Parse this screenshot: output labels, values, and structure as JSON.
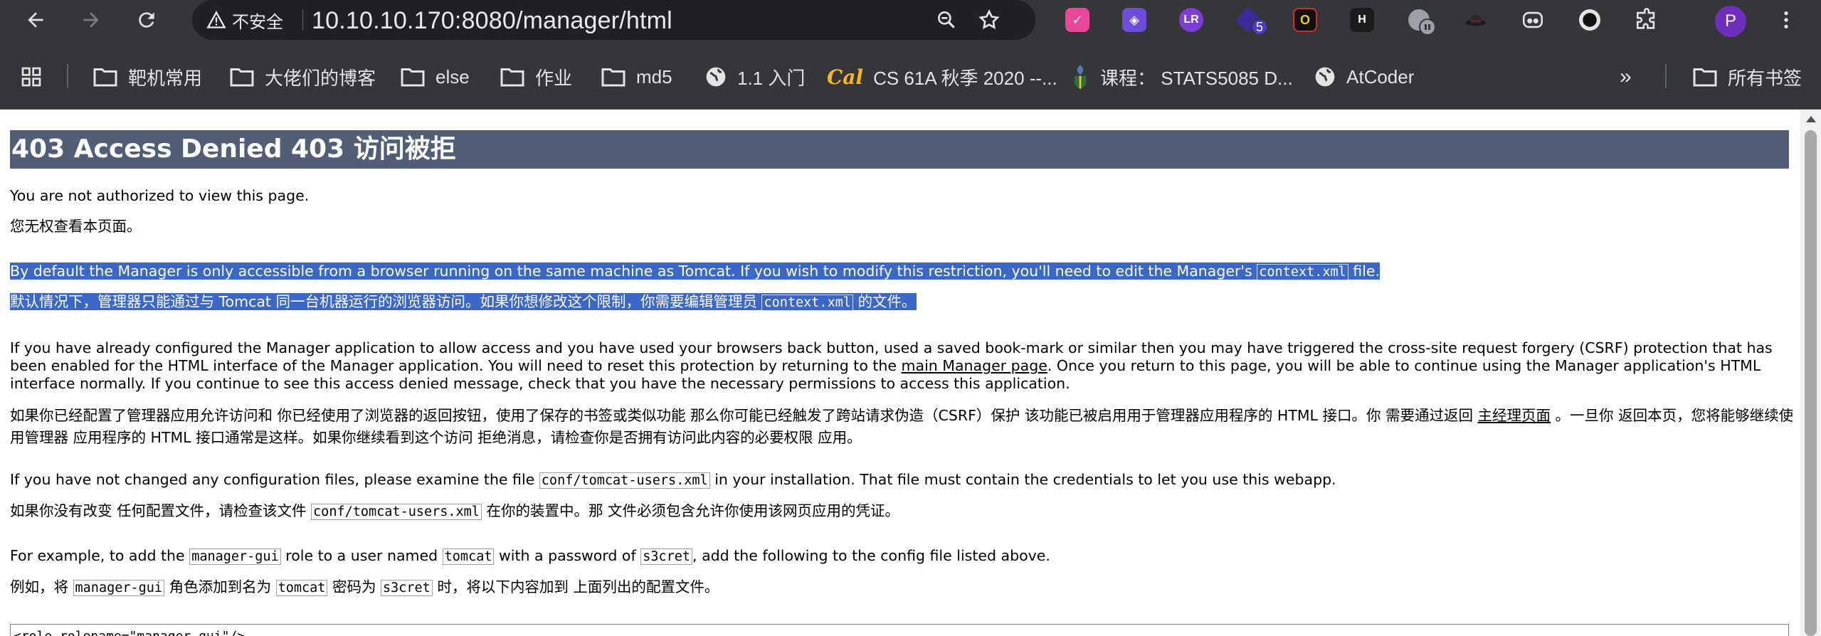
{
  "browser": {
    "security_label": "不安全",
    "url": "10.10.10.170:8080/manager/html",
    "extension_badge": "5",
    "profile_initial": "P"
  },
  "bookmarks": {
    "items": [
      {
        "label": "靶机常用",
        "icon": "folder-icon"
      },
      {
        "label": "大佬们的博客",
        "icon": "folder-icon"
      },
      {
        "label": "else",
        "icon": "folder-icon"
      },
      {
        "label": "作业",
        "icon": "folder-icon"
      },
      {
        "label": "md5",
        "icon": "folder-icon"
      },
      {
        "label": "1.1 入门",
        "icon": "globe-icon"
      },
      {
        "label": "CS 61A 秋季 2020 --...",
        "icon": "cal-logo-icon"
      },
      {
        "label": "课程： STATS5085 D...",
        "icon": "crest-icon"
      },
      {
        "label": "AtCoder",
        "icon": "globe-icon"
      }
    ],
    "more_label": "»",
    "all_bookmarks": "所有书签"
  },
  "page": {
    "heading": "403 Access Denied  403 访问被拒",
    "p1_en": "You are not authorized to view this page.",
    "p1_zh": "您无权查看本页面。",
    "p2_en_a": "By default the Manager is only accessible from a browser running on the same machine as Tomcat. If you wish to modify this restriction, you'll need to edit the Manager's ",
    "p2_code": "context.xml",
    "p2_en_b": " file.",
    "p2_zh_a": "默认情况下，管理器只能通过与 Tomcat 同一台机器运行的浏览器访问。如果你想修改这个限制，你需要编辑管理员 ",
    "p2_zh_b": " 的文件。",
    "p3_en_a": "If you have already configured the Manager application to allow access and you have used your browsers back button, used a saved book-mark or similar then you may have triggered the cross-site request forgery (CSRF) protection that has been enabled for the HTML interface of the Manager application. You will need to reset this protection by returning to the ",
    "p3_link": "main Manager page",
    "p3_en_b": ". Once you return to this page, you will be able to continue using the Manager application's HTML interface normally. If you continue to see this access denied message, check that you have the necessary permissions to access this application.",
    "p3_zh_a": "如果你已经配置了管理器应用允许访问和 你已经使用了浏览器的返回按钮，使用了保存的书签或类似功能 那么你可能已经触发了跨站请求伪造（CSRF）保护 该功能已被启用用于管理器应用程序的 HTML 接口。你 需要通过返回 ",
    "p3_zh_link": "主经理页面",
    "p3_zh_b": " 。一旦你 返回本页，您将能够继续使用管理器 应用程序的 HTML 接口通常是这样。如果你继续看到这个访问 拒绝消息，请检查你是否拥有访问此内容的必要权限 应用。",
    "p4_en_a": "If you have not changed any configuration files, please examine the file ",
    "p4_code": "conf/tomcat-users.xml",
    "p4_en_b": " in your installation. That file must contain the credentials to let you use this webapp.",
    "p4_zh_a": "如果你没有改变 任何配置文件，请检查该文件 ",
    "p4_zh_b": " 在你的装置中。那 文件必须包含允许你使用该网页应用的凭证。",
    "p5_en_a": "For example, to add the ",
    "p5_code_role": "manager-gui",
    "p5_en_b": " role to a user named ",
    "p5_code_user": "tomcat",
    "p5_en_c": " with a password of ",
    "p5_code_pass": "s3cret",
    "p5_en_d": ", add the following to the config file listed above.",
    "p5_zh_a": "例如，将 ",
    "p5_zh_b": " 角色添加到名为 ",
    "p5_zh_c": " 密码为 ",
    "p5_zh_d": " 时，将以下内容加到 上面列出的配置文件。",
    "pre_line": "<role rolename=\"manager-gui\"/>"
  },
  "colors": {
    "toolbar_bg": "#35363a",
    "omnibox_bg": "#202124",
    "heading_bg": "#525d76",
    "selection_bg": "#3b67c9"
  }
}
